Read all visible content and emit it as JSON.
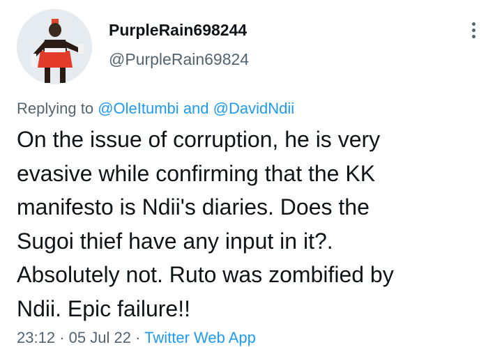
{
  "author": {
    "display_name": "PurpleRain698244",
    "handle": "@PurpleRain69824"
  },
  "reply": {
    "prefix": "Replying to",
    "mention_1": "@OleItumbi",
    "conjunction": "and",
    "mention_2": "@DavidNdii"
  },
  "tweet": {
    "text_lines": [
      "On the issue of corruption, he is very",
      "evasive while confirming that the KK",
      "manifesto is Ndii's diaries. Does the",
      "Sugoi thief have any input in it?.",
      "Absolutely not. Ruto was zombified by",
      "Ndii. Epic failure!!"
    ]
  },
  "meta": {
    "time": "23:12",
    "date": "05 Jul 22",
    "separator": "·",
    "source": "Twitter Web App"
  },
  "icons": {
    "more": "more-vertical-icon"
  },
  "colors": {
    "accent": "#1d9bf0",
    "secondary_text": "#536471",
    "primary_text": "#0f1419"
  }
}
